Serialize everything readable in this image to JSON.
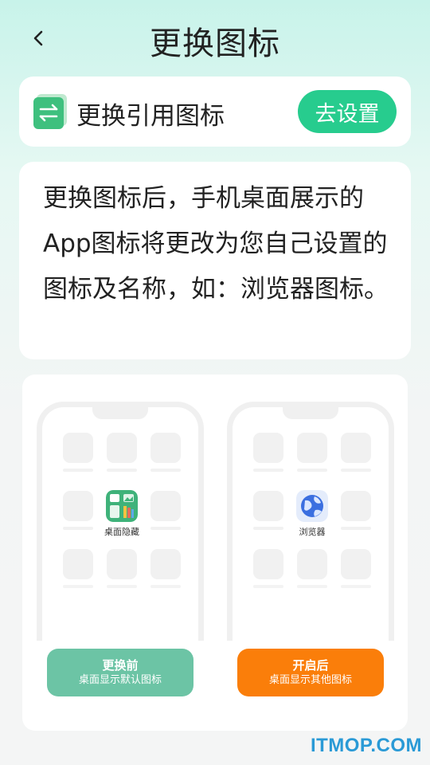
{
  "header": {
    "title": "更换图标"
  },
  "change_card": {
    "label": "更换引用图标",
    "button": "去设置",
    "icon": "swap-arrows-icon"
  },
  "description": {
    "text": "更换图标后，手机桌面展示的App图标将更改为您自己设置的图标及名称，如：浏览器图标。"
  },
  "preview": {
    "before": {
      "app_label": "桌面隐藏",
      "title": "更换前",
      "subtitle": "桌面显示默认图标",
      "color": "#6cc4a5"
    },
    "after": {
      "app_label": "浏览器",
      "title": "开启后",
      "subtitle": "桌面显示其他图标",
      "color": "#fa7e0a"
    }
  },
  "watermark": "ITMOP.COM",
  "colors": {
    "accent": "#27cc8e"
  }
}
